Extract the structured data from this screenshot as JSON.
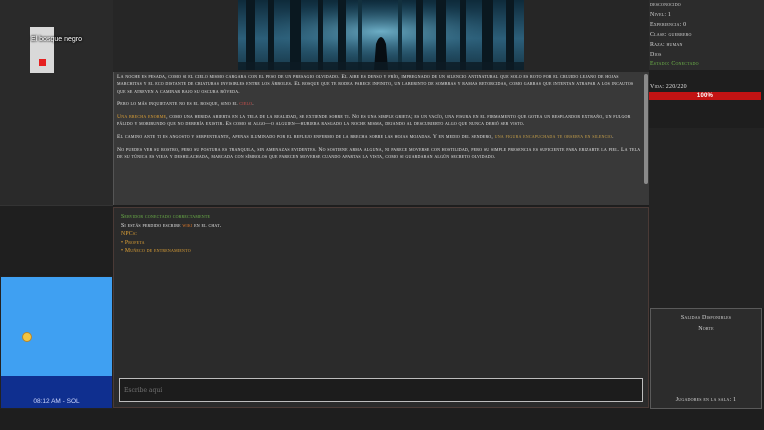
{
  "map": {
    "location_label": "El bosque negro"
  },
  "clock": {
    "time": "08:12 AM - SOL"
  },
  "story": {
    "p1": "La noche es pesada, como si el cielo mismo cargara con el peso de un presagio olvidado. El aire es denso y frío, impregnado de un silencio antinatural que solo es roto por el crujido lejano de hojas marchitas y el eco distante de criaturas invisibles entre los árboles. El bosque que te rodea parece infinito, un laberinto de sombras y ramas retorcidas, como garras que intentan atrapar a los incautos que se atreven a caminar bajo su oscura bóveda.",
    "p2_a": "Pero lo más inquietante no es el bosque, sino el ",
    "p2_hl": "cielo",
    "p2_b": ".",
    "p3_hl": "Una brecha enorme",
    "p3_b": ", como una herida abierta en la tela de la realidad, se extiende sobre ti. No es una simple grieta; es un vacío, una fisura en el firmamento que gotea un resplandor extraño, un fulgor pálido y moribundo que no debería existir. Es como si algo—o alguien—hubiera rasgado la noche misma, dejando al descubierto algo que nunca debió ser visto.",
    "p4_a": "El camino ante ti es angosto y serpenteante, apenas iluminado por el reflejo enfermo de la brecha sobre las hojas mojadas. Y en medio del sendero, ",
    "p4_hl": "una figura encapuchada te observa en silencio",
    "p4_b": ".",
    "p5": "No puedes ver su rostro, pero su postura es tranquila, sin amenazas evidentes. No sostiene arma alguna, ni parece moverse con hostilidad, pero su simple presencia es suficiente para erizarte la piel. La tela de su túnica es vieja y deshilachada, marcada con símbolos que parecen moverse cuando apartas la vista, como si guardaran algún secreto olvidado."
  },
  "chat": {
    "server_msg": "Servidor conectado correctamente",
    "hint_a": "Si estás perdido escribe ",
    "hint_wiki": "wiki",
    "hint_b": " en el chat.",
    "npcs_title": "NPCs:",
    "npcs": [
      "• Profeta",
      "• Muñeco de entrenamiento"
    ],
    "input_placeholder": "Escribe aquí"
  },
  "stats": {
    "name": "desconocido",
    "level": "Nivel: 1",
    "experience": "Experiencia: 0",
    "class": "Clase: guerrero",
    "race": "Raza: human",
    "god": "Dios",
    "status": "Estado: Conectado"
  },
  "life": {
    "label": "Vida: 220/220",
    "bar_text": "100%",
    "fraction": 1.0
  },
  "exits": {
    "title": "Salidas Disponibles",
    "items": [
      "Norte"
    ],
    "players": "Jugadores en la sala: 1"
  },
  "colors": {
    "life_bar": "#c21313",
    "connected": "#6fb84a",
    "highlight": "#e0a236"
  }
}
